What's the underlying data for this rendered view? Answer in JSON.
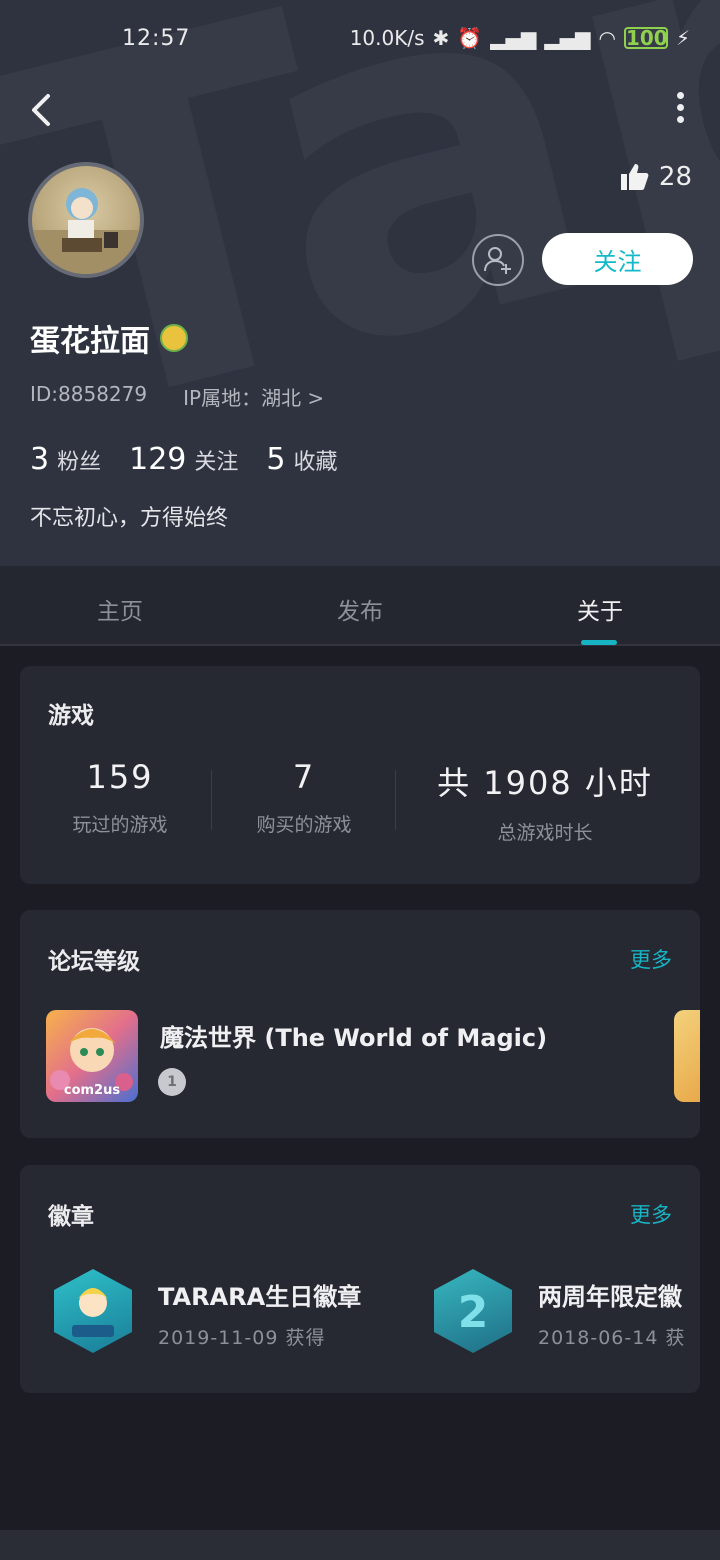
{
  "status_bar": {
    "time": "12:57",
    "net_speed": "10.0K/s",
    "battery": "100"
  },
  "profile": {
    "likes": "28",
    "username": "蛋花拉面",
    "id_text": "ID:8858279",
    "ip_text": "IP属地：湖北 >",
    "follow_label": "关注",
    "stats": [
      {
        "num": "3",
        "label": "粉丝"
      },
      {
        "num": "129",
        "label": "关注"
      },
      {
        "num": "5",
        "label": "收藏"
      }
    ],
    "bio": "不忘初心，方得始终"
  },
  "tabs": [
    {
      "label": "主页"
    },
    {
      "label": "发布"
    },
    {
      "label": "关于"
    }
  ],
  "games_card": {
    "title": "游戏",
    "stats": [
      {
        "num": "159",
        "label": "玩过的游戏"
      },
      {
        "num": "7",
        "label": "购买的游戏"
      },
      {
        "num": "共 1908 小时",
        "label": "总游戏时长"
      }
    ]
  },
  "forum_card": {
    "title": "论坛等级",
    "more": "更多",
    "item_name": "魔法世界 (The World of Magic)",
    "icon_text": "com2us",
    "level": "1"
  },
  "badges_card": {
    "title": "徽章",
    "more": "更多",
    "items": [
      {
        "name": "TARARA生日徽章",
        "date": "2019-11-09 获得"
      },
      {
        "name": "两周年限定徽",
        "date": "2018-06-14 获"
      }
    ]
  },
  "colors": {
    "accent": "#17b4c4",
    "header_bg": "#2f3340",
    "page_bg": "#1b1c24",
    "card_bg": "#262832"
  }
}
